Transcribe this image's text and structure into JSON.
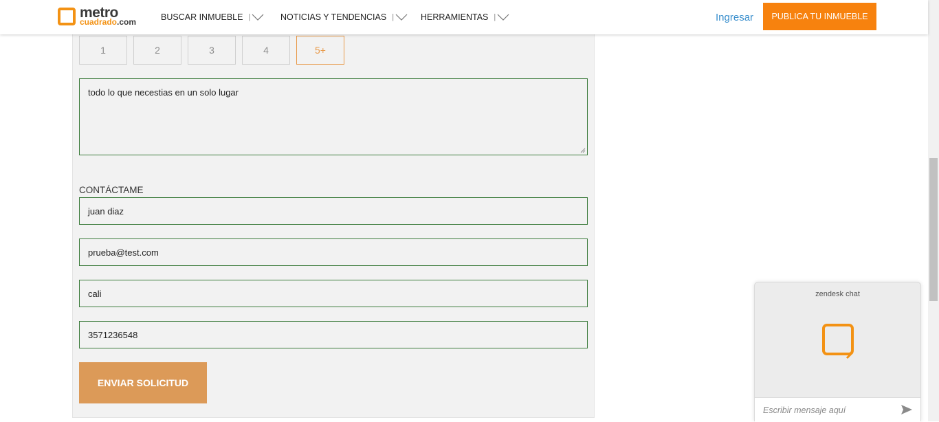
{
  "header": {
    "logo_top": "metro",
    "logo_bottom_1": "cuadrado",
    "logo_bottom_2": ".com",
    "nav": [
      {
        "label": "BUSCAR INMUEBLE",
        "icon": "chevron-down-icon"
      },
      {
        "label": "NOTICIAS Y TENDENCIAS",
        "icon": "chevron-down-icon"
      },
      {
        "label": "HERRAMIENTAS",
        "icon": "chevron-down-icon"
      }
    ],
    "separator": "|",
    "login": "Ingresar",
    "publish": "PUBLICA TU INMUEBLE"
  },
  "form": {
    "number_options": [
      "1",
      "2",
      "3",
      "4",
      "5+"
    ],
    "selected_option": "5+",
    "message": "todo lo que necestias en un solo lugar",
    "contact_label": "CONTÁCTAME",
    "name": "juan diaz",
    "email": "prueba@test.com",
    "city": "cali",
    "phone": "3571236548",
    "submit": "ENVIAR SOLICITUD"
  },
  "chat": {
    "title": "zendesk chat",
    "placeholder": "Escribir mensaje aquí",
    "send_icon": "send-icon"
  },
  "colors": {
    "brand_orange": "#f7820e",
    "submit": "#dc9a58",
    "field_border": "#3a7a3a",
    "link": "#3a8fcd"
  }
}
